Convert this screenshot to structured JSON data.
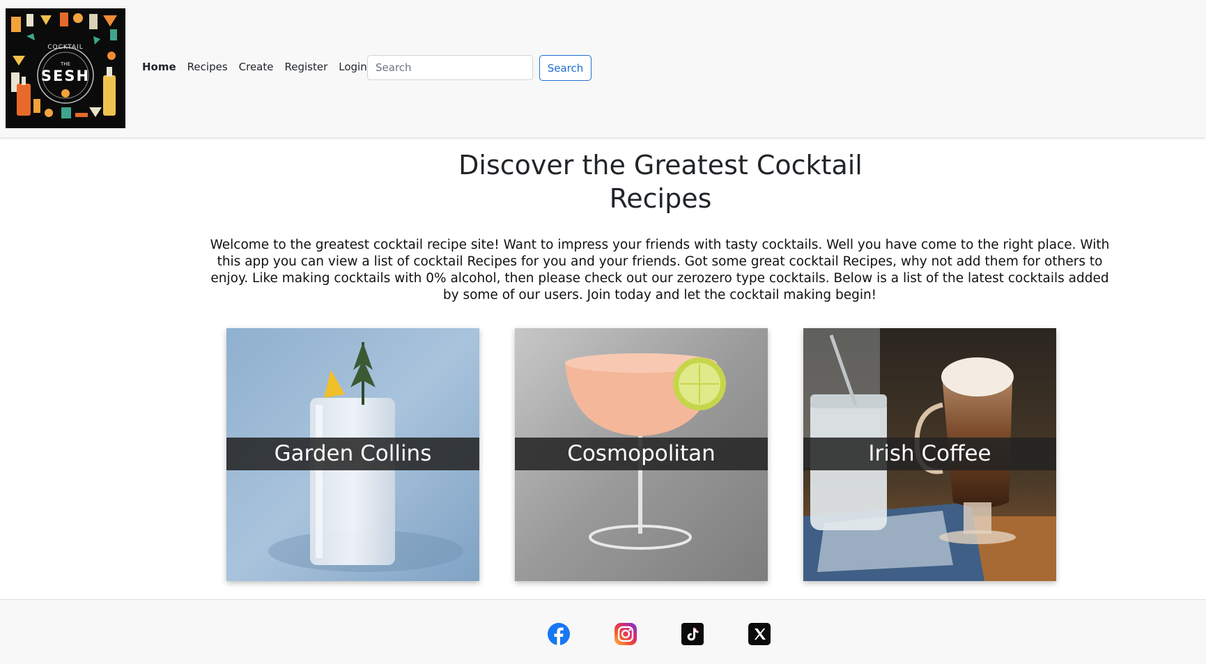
{
  "navbar": {
    "logo_alt": "The Cocktail Sesh",
    "logo_text": {
      "arc": "COCKTAIL",
      "small": "THE",
      "big": "SESH"
    },
    "links": [
      {
        "label": "Home",
        "active": true
      },
      {
        "label": "Recipes",
        "active": false
      },
      {
        "label": "Create",
        "active": false
      },
      {
        "label": "Register",
        "active": false
      },
      {
        "label": "Login",
        "active": false
      }
    ],
    "search": {
      "placeholder": "Search",
      "button_label": "Search"
    }
  },
  "main": {
    "title_line1": "Discover the Greatest Cocktail",
    "title_line2": "Recipes",
    "intro": "Welcome to the greatest cocktail recipe site! Want to impress your friends with tasty cocktails. Well you have come to the right place. With this app you can view a list of cocktail Recipes for you and your friends. Got some great cocktail Recipes, why not add them for others to enjoy. Like making cocktails with 0% alcohol, then please check out our zerozero type cocktails. Below is a list of the latest cocktails added by some of our users. Join today and let the cocktail making begin!",
    "cards": [
      {
        "title": "Garden Collins"
      },
      {
        "title": "Cosmopolitan"
      },
      {
        "title": "Irish Coffee"
      }
    ]
  },
  "footer": {
    "social": [
      "facebook-icon",
      "instagram-icon",
      "tiktok-icon",
      "x-icon"
    ]
  },
  "colors": {
    "navbar_bg": "#f8f8f8",
    "accent": "#1f6fd0",
    "card_band": "#232323",
    "facebook": "#1877f2"
  }
}
